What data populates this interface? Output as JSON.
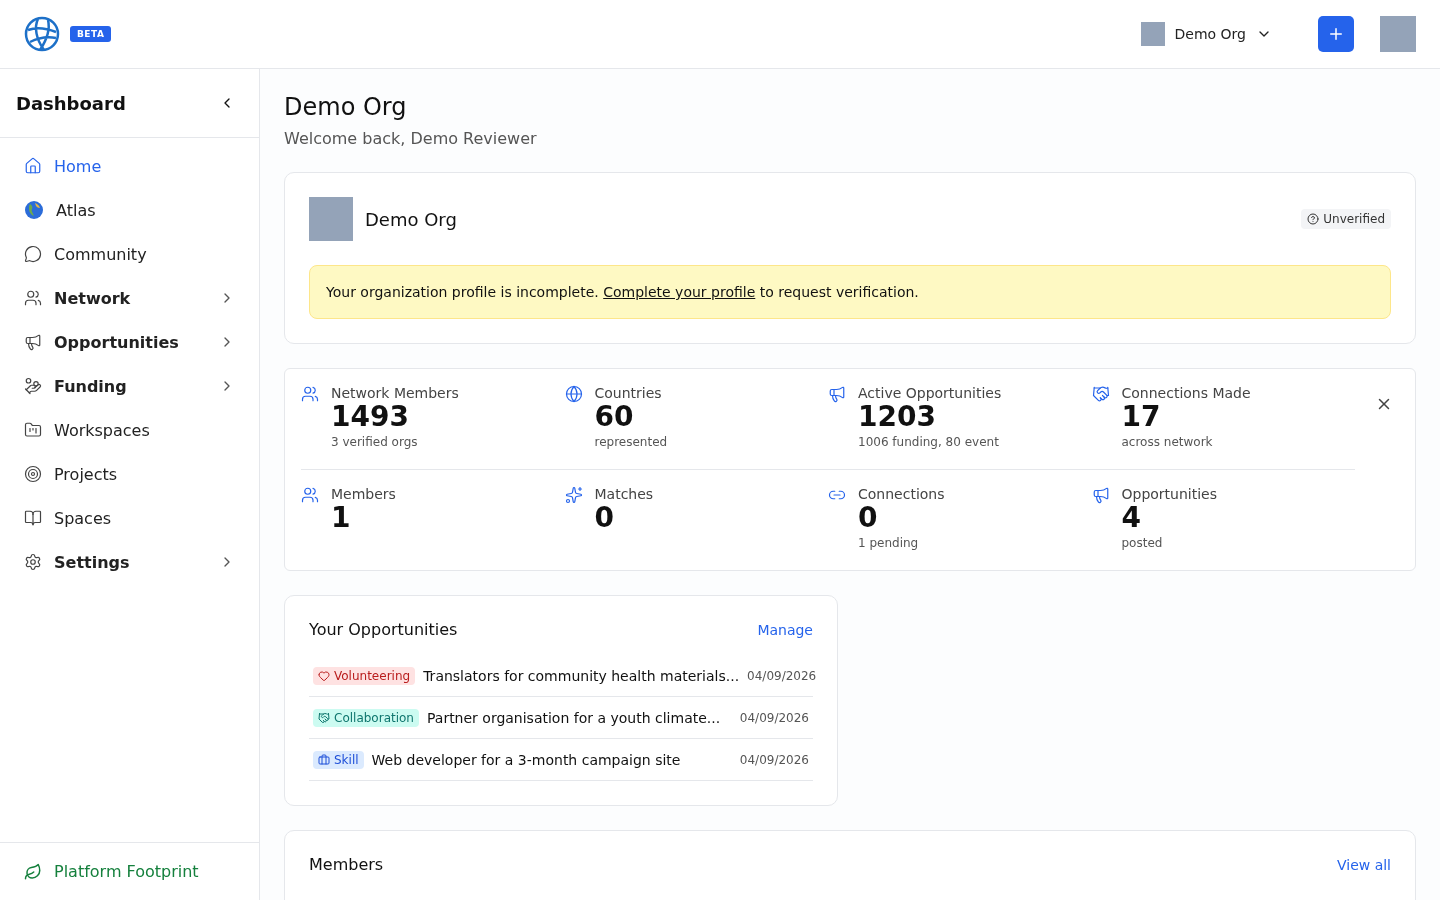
{
  "header": {
    "badge": "BETA",
    "org_switcher": "Demo Org"
  },
  "sidebar": {
    "title": "Dashboard",
    "items": [
      {
        "label": "Home",
        "selected": true,
        "expandable": false
      },
      {
        "label": "Atlas",
        "selected": false,
        "expandable": false
      },
      {
        "label": "Community",
        "selected": false,
        "expandable": false
      },
      {
        "label": "Network",
        "selected": false,
        "expandable": true
      },
      {
        "label": "Opportunities",
        "selected": false,
        "expandable": true
      },
      {
        "label": "Funding",
        "selected": false,
        "expandable": true
      },
      {
        "label": "Workspaces",
        "selected": false,
        "expandable": false
      },
      {
        "label": "Projects",
        "selected": false,
        "expandable": false
      },
      {
        "label": "Spaces",
        "selected": false,
        "expandable": false
      },
      {
        "label": "Settings",
        "selected": false,
        "expandable": true
      }
    ],
    "footer": "Platform Footprint"
  },
  "page": {
    "title": "Demo Org",
    "subtitle": "Welcome back, Demo Reviewer"
  },
  "org_card": {
    "name": "Demo Org",
    "status": "Unverified",
    "notice": "Your organization profile is incomplete. ",
    "notice_link": "Complete your profile",
    "notice_end": " to request verification."
  },
  "stats": [
    [
      {
        "label": "Network Members",
        "value": "1493",
        "note": "3 verified orgs"
      },
      {
        "label": "Countries",
        "value": "60",
        "note": "represented"
      },
      {
        "label": "Active Opportunities",
        "value": "1203",
        "note": "1006 funding, 80 event"
      },
      {
        "label": "Connections Made",
        "value": "17",
        "note": "across network"
      }
    ],
    [
      {
        "label": "Members",
        "value": "1"
      },
      {
        "label": "Matches",
        "value": "0"
      },
      {
        "label": "Connections",
        "value": "0",
        "note": "1 pending"
      },
      {
        "label": "Opportunities",
        "value": "4",
        "note": "posted"
      }
    ]
  ],
  "opportunities": {
    "title": "Your Opportunities",
    "action": "Manage",
    "rows": [
      {
        "kind": "volunteering",
        "tag": "Volunteering",
        "title": "Translators for community health materials...",
        "date": "04/09/2026"
      },
      {
        "kind": "collaboration",
        "tag": "Collaboration",
        "title": "Partner organisation for a youth climate...",
        "date": "04/09/2026"
      },
      {
        "kind": "skill",
        "tag": "Skill",
        "title": "Web developer for a 3-month campaign site",
        "date": "04/09/2026"
      }
    ]
  },
  "members": {
    "title": "Members",
    "action": "View all"
  }
}
